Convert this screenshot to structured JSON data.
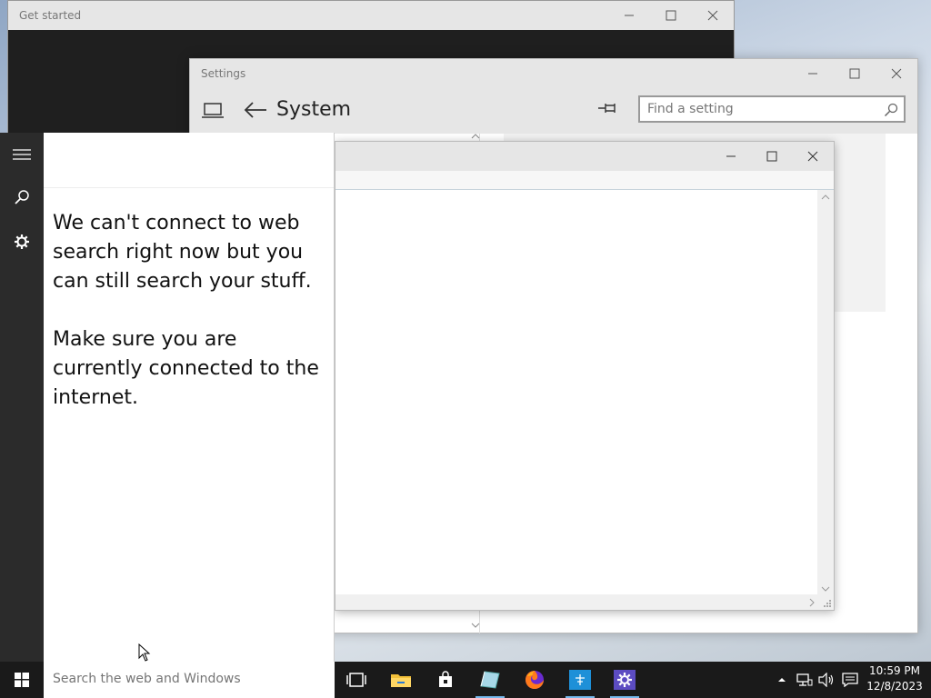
{
  "windows": {
    "get_started": {
      "title": "Get started"
    },
    "settings": {
      "title": "Settings",
      "header_title": "System",
      "search_placeholder": "Find a setting"
    }
  },
  "search_panel": {
    "message_line1": "We can't connect to web search right now but you can still search your stuff.",
    "message_line2": "Make sure you are currently connected to the internet."
  },
  "taskbar": {
    "search_placeholder": "Search the web and Windows",
    "clock_time": "10:59 PM",
    "clock_date": "12/8/2023",
    "pinned": [
      "task-view-icon",
      "file-explorer-icon",
      "store-icon",
      "app-icon",
      "firefox-icon",
      "network-app-icon",
      "settings-icon"
    ]
  },
  "colors": {
    "taskbar": "#1a1a1a",
    "rail": "#2b2b2b",
    "accent": "#0078d7",
    "settings_gear_bg": "#5c4cc2"
  }
}
